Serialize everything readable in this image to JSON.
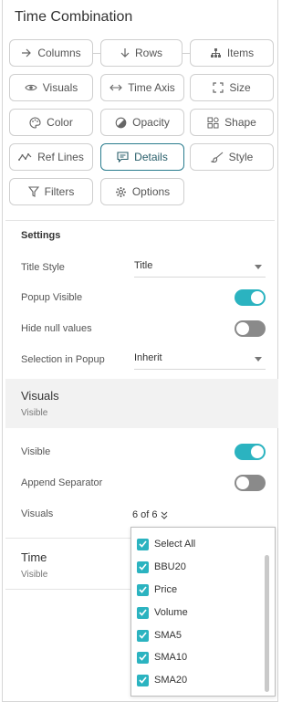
{
  "panel": {
    "title": "Time Combination"
  },
  "toolbar": {
    "columns": "Columns",
    "rows": "Rows",
    "items": "Items",
    "visuals": "Visuals",
    "time_axis": "Time Axis",
    "size": "Size",
    "color": "Color",
    "opacity": "Opacity",
    "shape": "Shape",
    "ref_lines": "Ref Lines",
    "details": "Details",
    "style": "Style",
    "filters": "Filters",
    "options": "Options",
    "active": "details"
  },
  "settings": {
    "heading": "Settings",
    "title_style_label": "Title Style",
    "title_style_value": "Title",
    "popup_visible_label": "Popup Visible",
    "popup_visible": true,
    "hide_null_label": "Hide null values",
    "hide_null": false,
    "selection_popup_label": "Selection in Popup",
    "selection_popup_value": "Inherit"
  },
  "visuals_section": {
    "title": "Visuals",
    "subtitle": "Visible",
    "visible_label": "Visible",
    "visible": true,
    "append_sep_label": "Append Separator",
    "append_sep": false,
    "visuals_label": "Visuals",
    "visuals_count": "6 of 6"
  },
  "time_section": {
    "title": "Time",
    "subtitle": "Visible"
  },
  "visuals_dropdown": {
    "items": [
      {
        "label": "Select All",
        "checked": true
      },
      {
        "label": "BBU20",
        "checked": true
      },
      {
        "label": "Price",
        "checked": true
      },
      {
        "label": "Volume",
        "checked": true
      },
      {
        "label": "SMA5",
        "checked": true
      },
      {
        "label": "SMA10",
        "checked": true
      },
      {
        "label": "SMA20",
        "checked": true
      }
    ]
  },
  "colors": {
    "accent": "#2bb3c0",
    "active_border": "#2a7c8e",
    "toggle_off": "#8a8a8a"
  },
  "icons": {
    "columns": "arrow-right-icon",
    "rows": "arrow-down-icon",
    "items": "hierarchy-icon",
    "visuals": "eye-icon",
    "time_axis": "double-arrow-icon",
    "size": "resize-corners-icon",
    "color": "palette-icon",
    "opacity": "opacity-icon",
    "shape": "shapes-icon",
    "ref_lines": "line-chart-icon",
    "details": "comment-icon",
    "style": "brush-icon",
    "filters": "funnel-icon",
    "options": "gear-icon"
  }
}
